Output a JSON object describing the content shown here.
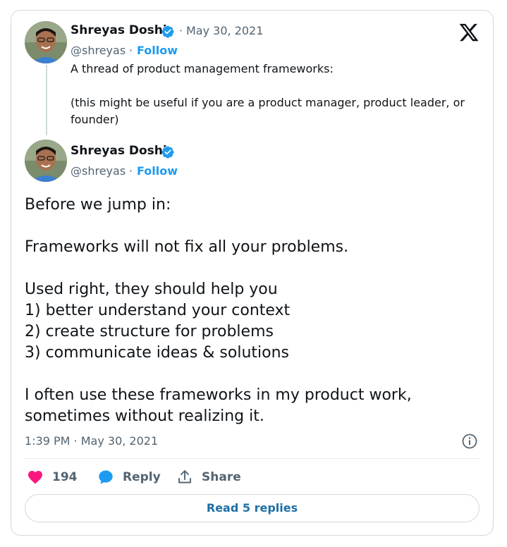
{
  "quoted_tweet": {
    "author_name": "Shreyas Doshi",
    "separator": "·",
    "date": "May 30, 2021",
    "handle": "@shreyas",
    "follow_separator": "·",
    "follow_label": "Follow",
    "text_line1": "A thread of product management frameworks:",
    "text_line2": "(this might be useful if you are a product manager, product leader, or founder)"
  },
  "main_tweet": {
    "author_name": "Shreyas Doshi",
    "handle": "@shreyas",
    "follow_separator": "·",
    "follow_label": "Follow",
    "lines": [
      "Before we jump in:",
      "Frameworks will not fix all your problems.",
      "Used right, they should help you",
      "1) better understand your context",
      "2) create structure for problems",
      "3) communicate ideas & solutions",
      "I often use these frameworks in my product work,",
      "sometimes without realizing it."
    ],
    "timestamp": "1:39 PM · May 30, 2021"
  },
  "actions": {
    "like_count": "194",
    "reply_label": "Reply",
    "share_label": "Share"
  },
  "read_replies_label": "Read 5 replies",
  "colors": {
    "accent": "#1d9bf0",
    "like": "#f91880",
    "muted": "#536471",
    "border": "#cfd9de"
  },
  "icons": [
    "verified-badge-icon",
    "x-logo-icon",
    "info-icon",
    "heart-icon",
    "reply-bubble-icon",
    "share-icon"
  ]
}
